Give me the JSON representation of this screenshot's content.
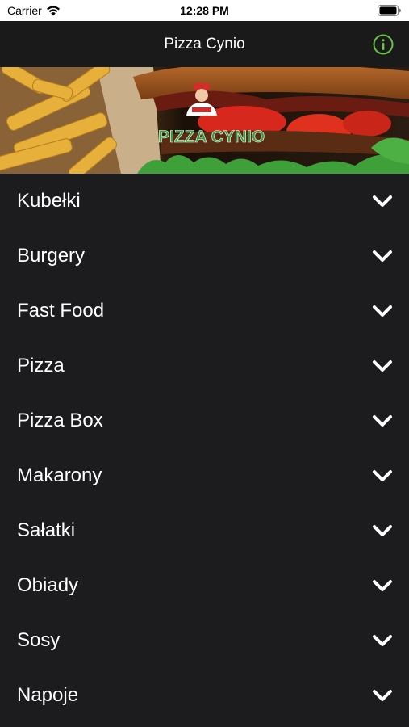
{
  "status_bar": {
    "carrier": "Carrier",
    "time": "12:28 PM"
  },
  "nav": {
    "title": "Pizza Cynio",
    "info_icon": "info-circle-icon",
    "accent_color": "#6cc04a"
  },
  "banner": {
    "logo_text": "PIZZA CYNIO"
  },
  "menu": {
    "items": [
      {
        "label": "Kubełki"
      },
      {
        "label": "Burgery"
      },
      {
        "label": "Fast Food"
      },
      {
        "label": "Pizza"
      },
      {
        "label": "Pizza Box"
      },
      {
        "label": "Makarony"
      },
      {
        "label": "Sałatki"
      },
      {
        "label": "Obiady"
      },
      {
        "label": "Sosy"
      },
      {
        "label": "Napoje"
      }
    ],
    "expand_icon": "chevron-down-icon"
  }
}
